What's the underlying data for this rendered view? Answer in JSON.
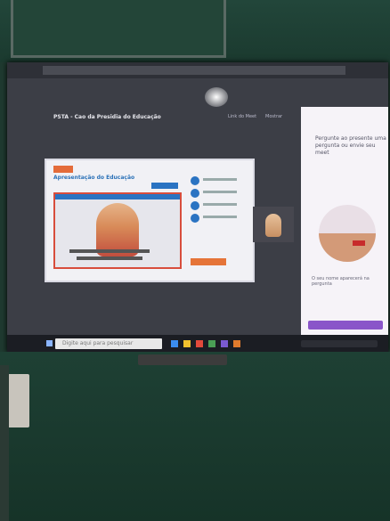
{
  "scene": {
    "meeting_title": "PSTA - Cao da Presidia do Educação",
    "header_links": [
      "Link do Meet",
      "Mostrar"
    ],
    "panel_question": "Pergunte ao presente uma pergunta ou envie seu meet",
    "panel_footer": "O seu nome aparecerá na pergunta",
    "slide_heading": "Apresentação do Educação",
    "taskbar_search": "Digite aqui para pesquisar"
  }
}
